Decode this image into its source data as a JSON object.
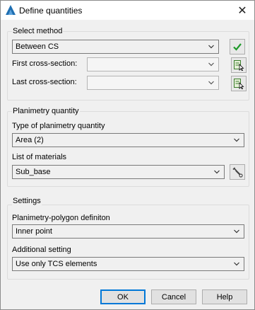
{
  "window": {
    "title": "Define quantities",
    "close_glyph": "✕"
  },
  "select_method": {
    "legend": "Select method",
    "method": {
      "value": "Between CS",
      "options": [
        "Between CS"
      ]
    },
    "first_cs_label": "First cross-section:",
    "first_cs_value": "",
    "last_cs_label": "Last cross-section:",
    "last_cs_value": ""
  },
  "planimetry": {
    "legend": "Planimetry quantity",
    "type_label": "Type of planimetry quantity",
    "type_value": "Area (2)",
    "materials_label": "List of materials",
    "materials_value": "Sub_base"
  },
  "settings": {
    "legend": "Settings",
    "polygon_label": "Planimetry-polygon definiton",
    "polygon_value": "Inner point",
    "additional_label": "Additional setting",
    "additional_value": "Use only TCS elements"
  },
  "buttons": {
    "ok": "OK",
    "cancel": "Cancel",
    "help": "Help"
  },
  "icons": {
    "app": "autocad-logo-icon",
    "apply": "checkmark-icon",
    "pick": "pick-cross-section-icon",
    "tools": "wrench-settings-icon"
  },
  "colors": {
    "accent": "#0078d7",
    "check": "#1f9a2a"
  }
}
